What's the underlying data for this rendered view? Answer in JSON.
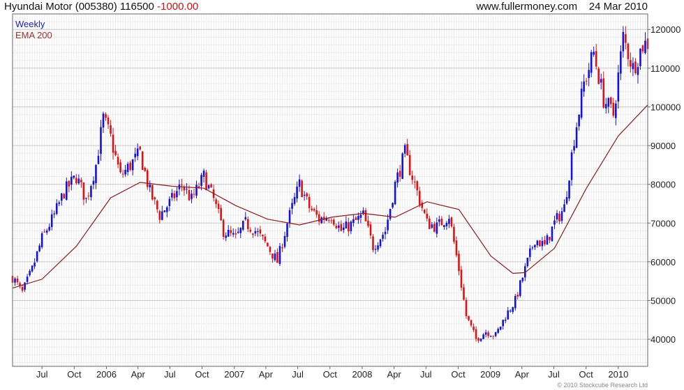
{
  "header": {
    "title": "Hyundai Motor (005380) 116500",
    "change": "-1000.00",
    "site": "www.fullermoney.com",
    "date": "24 Mar 2010"
  },
  "legend": {
    "weekly": "Weekly",
    "ema": "EMA 200"
  },
  "copyright": "© 2010 Stockcube Research Ltd",
  "colors": {
    "up": "#1010e0",
    "down": "#e01010",
    "ema": "#8b1a1a",
    "grid": "#d6d6d6",
    "frame": "#666666"
  },
  "chart_data": {
    "type": "candlestick",
    "ylim": [
      33000,
      124000
    ],
    "y_ticks": [
      40000,
      50000,
      60000,
      70000,
      80000,
      90000,
      100000,
      110000,
      120000
    ],
    "y_tick_labels": [
      "40000",
      "50000",
      "60000",
      "70000",
      "80000",
      "90000",
      "100000",
      "110000",
      "120000"
    ],
    "x_start": "2005-04-08",
    "x_end": "2010-03-26",
    "x_ticks": [
      "2005-07-01",
      "2005-10-01",
      "2006-01-01",
      "2006-04-01",
      "2006-07-01",
      "2006-10-01",
      "2007-01-01",
      "2007-04-01",
      "2007-07-01",
      "2007-10-01",
      "2008-01-01",
      "2008-04-01",
      "2008-07-01",
      "2008-10-01",
      "2009-01-01",
      "2009-04-01",
      "2009-07-01",
      "2009-10-01",
      "2010-01-01"
    ],
    "x_tick_labels": [
      "Jul",
      "Oct",
      "2006",
      "Apr",
      "Jul",
      "Oct",
      "2007",
      "Apr",
      "Jul",
      "Oct",
      "2008",
      "Apr",
      "Jul",
      "Oct",
      "2009",
      "Apr",
      "Jul",
      "Oct",
      "2010"
    ],
    "series": [
      {
        "name": "Weekly",
        "kind": "close",
        "x": [
          "2005-04-08",
          "2005-05-06",
          "2005-06-03",
          "2005-07-01",
          "2005-08-05",
          "2005-09-02",
          "2005-10-07",
          "2005-11-04",
          "2005-12-02",
          "2005-12-23",
          "2006-01-13",
          "2006-02-10",
          "2006-03-10",
          "2006-04-07",
          "2006-05-05",
          "2006-06-02",
          "2006-07-07",
          "2006-08-04",
          "2006-09-01",
          "2006-10-06",
          "2006-11-03",
          "2006-12-01",
          "2007-01-05",
          "2007-02-02",
          "2007-03-02",
          "2007-04-06",
          "2007-05-04",
          "2007-06-01",
          "2007-07-06",
          "2007-08-03",
          "2007-08-31",
          "2007-10-05",
          "2007-11-02",
          "2007-12-07",
          "2008-01-04",
          "2008-02-01",
          "2008-03-07",
          "2008-04-04",
          "2008-05-02",
          "2008-05-30",
          "2008-07-04",
          "2008-08-01",
          "2008-09-05",
          "2008-10-03",
          "2008-10-24",
          "2008-11-21",
          "2008-12-19",
          "2009-01-16",
          "2009-02-13",
          "2009-03-13",
          "2009-04-10",
          "2009-05-08",
          "2009-06-05",
          "2009-07-03",
          "2009-07-31",
          "2009-08-28",
          "2009-09-25",
          "2009-10-23",
          "2009-11-20",
          "2009-12-18",
          "2010-01-15",
          "2010-02-12",
          "2010-03-12",
          "2010-03-26"
        ],
        "values": [
          56000,
          52000,
          58000,
          66000,
          72000,
          78000,
          82000,
          76000,
          85000,
          97000,
          92000,
          82000,
          85000,
          88000,
          78000,
          72000,
          76000,
          80000,
          76000,
          82000,
          76000,
          68000,
          66000,
          70000,
          68000,
          64000,
          60000,
          70000,
          80000,
          74000,
          71000,
          72000,
          68000,
          70000,
          72000,
          64000,
          68000,
          80000,
          88000,
          80000,
          70000,
          69000,
          72000,
          58000,
          46000,
          40000,
          42000,
          41000,
          46000,
          50000,
          58000,
          66000,
          64000,
          70000,
          74000,
          92000,
          106000,
          114000,
          102000,
          98000,
          118000,
          110000,
          116000,
          116500
        ]
      },
      {
        "name": "EMA 200",
        "kind": "line",
        "x": [
          "2005-04-08",
          "2005-07-01",
          "2005-10-07",
          "2006-01-13",
          "2006-04-07",
          "2006-07-07",
          "2006-10-06",
          "2007-01-05",
          "2007-04-06",
          "2007-07-06",
          "2007-10-05",
          "2008-01-04",
          "2008-04-04",
          "2008-07-04",
          "2008-10-03",
          "2009-01-02",
          "2009-03-06",
          "2009-04-10",
          "2009-07-03",
          "2009-10-02",
          "2010-01-01",
          "2010-03-26"
        ],
        "values": [
          53200,
          55500,
          64000,
          76500,
          80500,
          79500,
          79000,
          74500,
          71000,
          69500,
          71500,
          72500,
          71500,
          75500,
          73500,
          61500,
          57000,
          57200,
          63500,
          79000,
          92500,
          100500
        ]
      }
    ]
  }
}
